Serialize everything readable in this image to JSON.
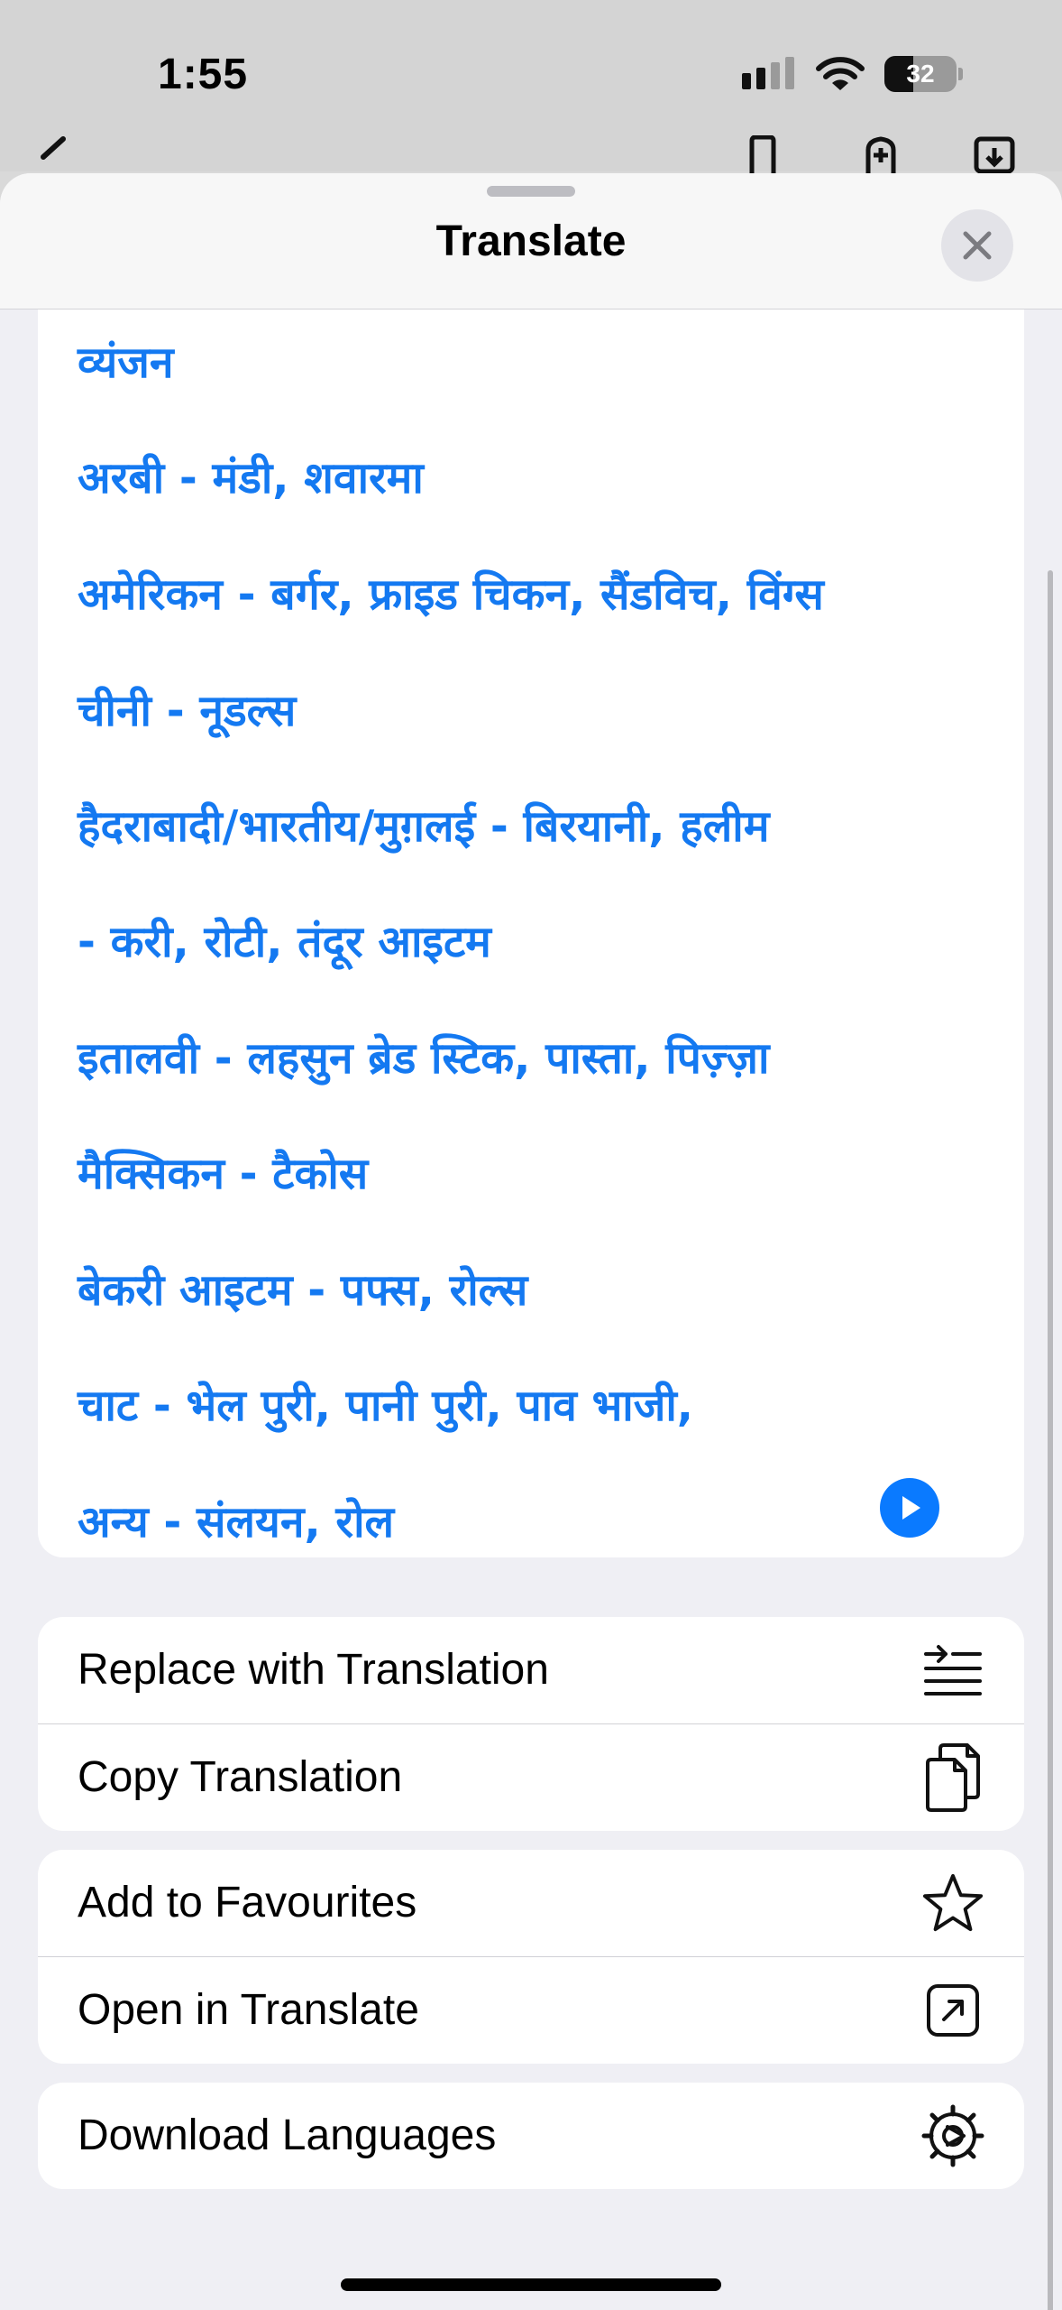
{
  "status_bar": {
    "time": "1:55",
    "battery_level": "32"
  },
  "sheet": {
    "title": "Translate"
  },
  "translation": {
    "lines": [
      "व्यंजन",
      "अरबी - मंडी, शवारमा",
      "अमेरिकन - बर्गर, फ्राइड चिकन, सैंडविच, विंग्स",
      "चीनी - नूडल्स",
      "हैदराबादी/भारतीय/मुग़लई - बिरयानी, हलीम",
      "- करी, रोटी, तंदूर आइटम",
      "इतालवी - लहसुन ब्रेड स्टिक, पास्ता, पिज़्ज़ा",
      "मैक्सिकन - टैकोस",
      "बेकरी आइटम - पफ्स, रोल्स",
      "चाट - भेल पुरी, पानी पुरी, पाव भाजी,",
      "अन्य - संलयन, रोल"
    ]
  },
  "actions": {
    "replace": "Replace with Translation",
    "copy": "Copy Translation",
    "favourites": "Add to Favourites",
    "open": "Open in Translate",
    "download": "Download Languages"
  },
  "colors": {
    "accent": "#0a7aff",
    "translation_text": "#1479f1"
  }
}
